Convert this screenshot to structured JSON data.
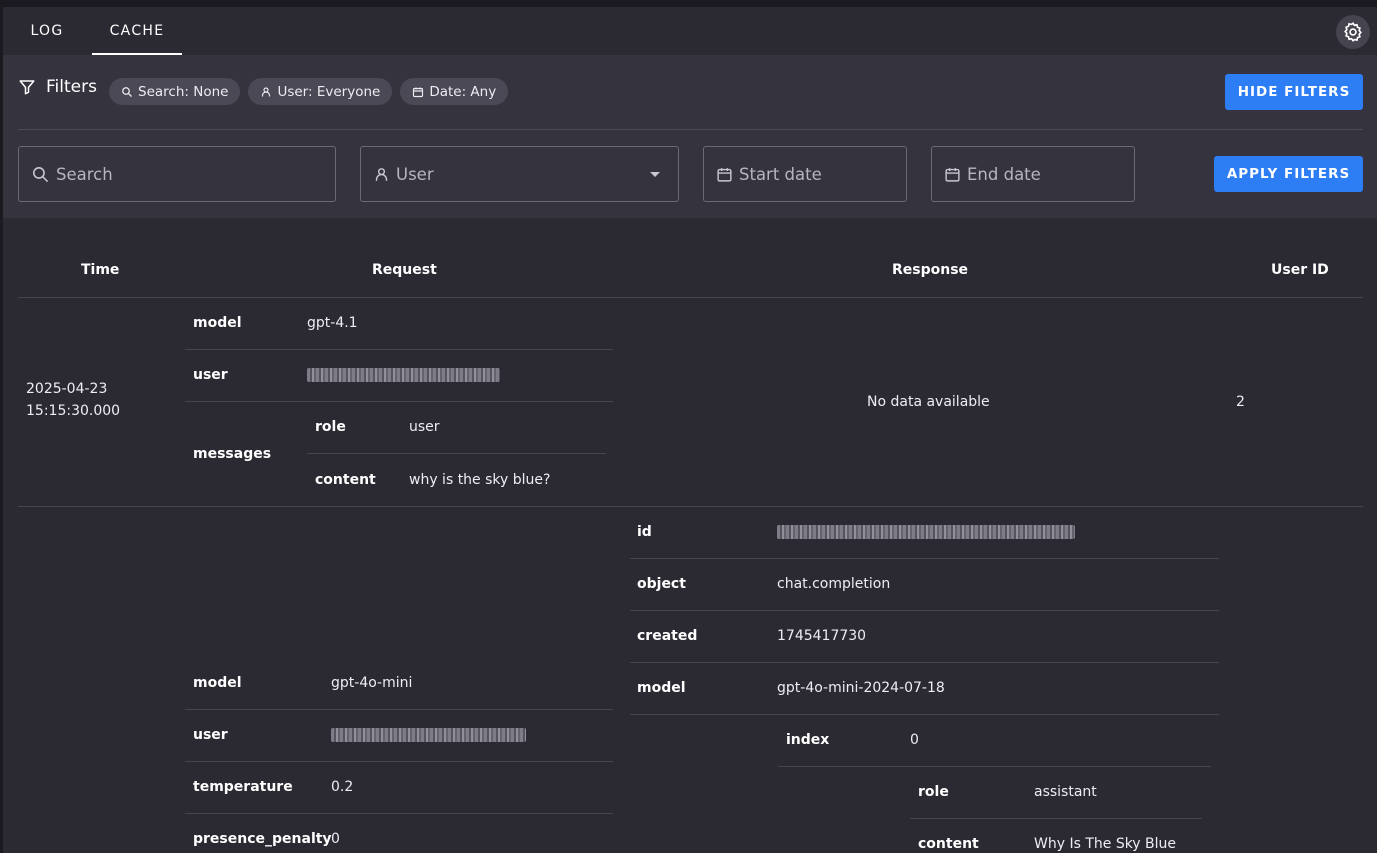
{
  "tabs": [
    {
      "label": "LOG",
      "active": false
    },
    {
      "label": "CACHE",
      "active": true
    }
  ],
  "filters": {
    "title": "Filters",
    "chips": [
      "Search: None",
      "User: Everyone",
      "Date: Any"
    ],
    "hide_label": "HIDE FILTERS",
    "search_placeholder": "Search",
    "user_placeholder": "User",
    "start_placeholder": "Start date",
    "end_placeholder": "End date",
    "apply_label": "APPLY FILTERS"
  },
  "table": {
    "headers": [
      "Time",
      "Request",
      "Response",
      "User ID"
    ],
    "row1": {
      "time_date": "2025-04-23",
      "time_clock": "15:15:30.000",
      "request": {
        "model_key": "model",
        "model_val": "gpt-4.1",
        "user_key": "user",
        "messages_key": "messages",
        "role_key": "role",
        "role_val": "user",
        "content_key": "content",
        "content_val": "why is the sky blue?"
      },
      "response_empty": "No data available",
      "user_id": "2"
    },
    "row2": {
      "request": {
        "model_key": "model",
        "model_val": "gpt-4o-mini",
        "user_key": "user",
        "temperature_key": "temperature",
        "temperature_val": "0.2",
        "presence_key": "presence_penalty",
        "presence_val": "0"
      },
      "response": {
        "id_key": "id",
        "object_key": "object",
        "object_val": "chat.completion",
        "created_key": "created",
        "created_val": "1745417730",
        "model_key": "model",
        "model_val": "gpt-4o-mini-2024-07-18",
        "index_key": "index",
        "index_val": "0",
        "role_key": "role",
        "role_val": "assistant",
        "content_key": "content",
        "content_val": "Why Is The Sky Blue"
      }
    }
  },
  "colors": {
    "accent": "#2d7df5",
    "panel": "#34333e",
    "background": "#2b2a33"
  }
}
